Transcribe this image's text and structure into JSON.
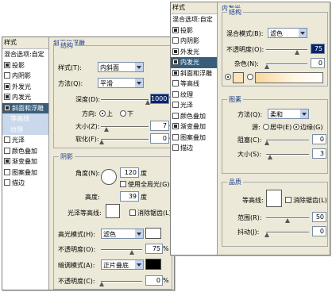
{
  "left": {
    "styles_header": "样式",
    "blend_default": "混合选项:自定",
    "style_items": [
      {
        "label": "投影",
        "checked": true,
        "state": ""
      },
      {
        "label": "内阴影",
        "checked": false,
        "state": ""
      },
      {
        "label": "外发光",
        "checked": true,
        "state": ""
      },
      {
        "label": "内发光",
        "checked": true,
        "state": ""
      },
      {
        "label": "斜面和浮雕",
        "checked": true,
        "state": "selected"
      },
      {
        "label": "等高线",
        "checked": false,
        "state": "sub"
      },
      {
        "label": "纹理",
        "checked": false,
        "state": "sub"
      },
      {
        "label": "光泽",
        "checked": false,
        "state": ""
      },
      {
        "label": "颜色叠加",
        "checked": false,
        "state": ""
      },
      {
        "label": "渐变叠加",
        "checked": true,
        "state": ""
      },
      {
        "label": "图案叠加",
        "checked": false,
        "state": ""
      },
      {
        "label": "描边",
        "checked": false,
        "state": ""
      }
    ],
    "bevel": {
      "group_title": "斜面和浮雕",
      "struct_title": "结构",
      "style_label": "样式(T):",
      "style_value": "内斜面",
      "method_label": "方法(Q):",
      "method_value": "平滑",
      "depth_label": "深度(D):",
      "depth_value": "1000",
      "depth_unit": "%",
      "direction_label": "方向:",
      "dir_up": "上",
      "dir_down": "下",
      "size_label": "大小(Z):",
      "size_value": "7",
      "size_unit": "像",
      "soften_label": "软化(F):",
      "soften_value": "0",
      "soften_unit": "像"
    },
    "shading": {
      "title": "阴影",
      "angle_label": "角度(N):",
      "angle_value": "120",
      "angle_unit": "度",
      "global_light": "使用全局光(G)",
      "altitude_label": "高度:",
      "altitude_value": "39",
      "altitude_unit": "度",
      "gloss_label": "光泽等高线:",
      "antialias": "消除锯齿(L)",
      "highlight_label": "高光模式(H):",
      "highlight_value": "滤色",
      "highlight_color": "#ffffff",
      "opacity_label": "不透明度(O):",
      "opacity_value": "75",
      "shadow_label": "暗调模式(A):",
      "shadow_value": "正片叠底",
      "shadow_color": "#000000",
      "opacity2_label": "不透明度(C):",
      "opacity2_value": "0"
    }
  },
  "right": {
    "styles_header": "样式",
    "blend_default": "混合选项:自定",
    "style_items": [
      {
        "label": "投影",
        "checked": true,
        "state": ""
      },
      {
        "label": "内阴影",
        "checked": false,
        "state": ""
      },
      {
        "label": "外发光",
        "checked": true,
        "state": ""
      },
      {
        "label": "内发光",
        "checked": true,
        "state": "selected"
      },
      {
        "label": "斜面和浮雕",
        "checked": true,
        "state": ""
      },
      {
        "label": "等高线",
        "checked": false,
        "state": ""
      },
      {
        "label": "纹理",
        "checked": false,
        "state": ""
      },
      {
        "label": "光泽",
        "checked": false,
        "state": ""
      },
      {
        "label": "颜色叠加",
        "checked": false,
        "state": ""
      },
      {
        "label": "渐变叠加",
        "checked": true,
        "state": ""
      },
      {
        "label": "图案叠加",
        "checked": false,
        "state": ""
      },
      {
        "label": "描边",
        "checked": false,
        "state": ""
      }
    ],
    "inner_glow": {
      "title": "内发光",
      "struct_title": "结构",
      "blend_label": "混合模式(B):",
      "blend_value": "滤色",
      "opacity_label": "不透明度(O):",
      "opacity_value": "75",
      "noise_label": "杂色(N):",
      "noise_value": "0",
      "glow_color": "#fde3b8"
    },
    "elements": {
      "title": "图素",
      "technique_label": "方法(Q):",
      "technique_value": "柔和",
      "source_label": "源:",
      "center": "居中(E)",
      "edge": "边缘(G)",
      "choke_label": "阻塞(C):",
      "choke_value": "0",
      "size_label": "大小(S):",
      "size_value": "3"
    },
    "quality": {
      "title": "品质",
      "contour_label": "等高线:",
      "antialias": "消除锯齿(L)",
      "range_label": "范围(R):",
      "range_value": "50",
      "jitter_label": "抖动(J):",
      "jitter_value": "0"
    }
  }
}
